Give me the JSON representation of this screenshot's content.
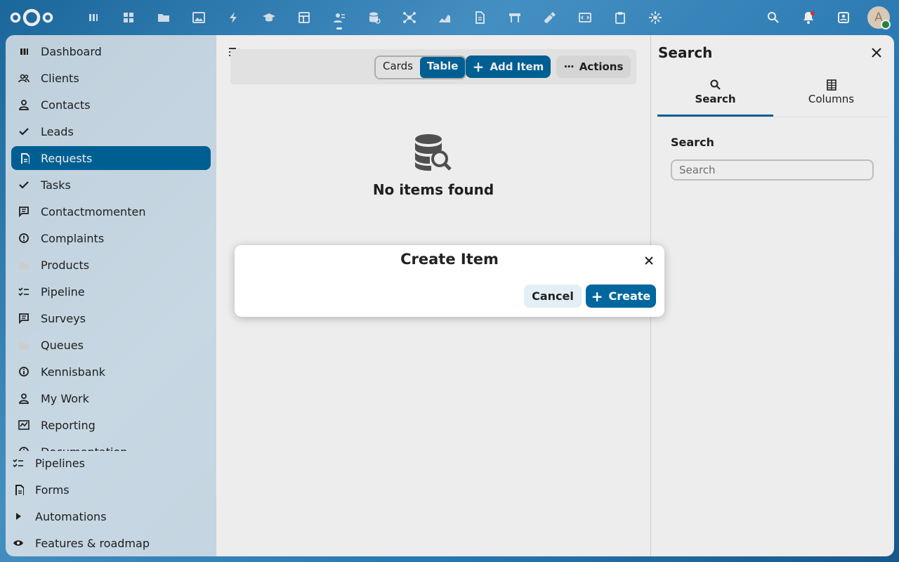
{
  "header": {
    "logo": "nextcloud-logo",
    "apps": [
      "app-dashboard-icon",
      "dashboard-grid-icon",
      "files-icon",
      "photos-icon",
      "activity-icon",
      "learning-icon",
      "tables-icon",
      "contacts-icon",
      "database-icon",
      "hub-icon",
      "analytics-icon",
      "document-icon",
      "board-icon",
      "tools-icon",
      "code-icon",
      "clipboard-icon",
      "settings-icon"
    ],
    "active_app_index": 7,
    "user_initial": "A"
  },
  "nav": {
    "items": [
      {
        "label": "Dashboard",
        "icon": "dashboard-icon"
      },
      {
        "label": "Clients",
        "icon": "clients-icon"
      },
      {
        "label": "Contacts",
        "icon": "contact-icon"
      },
      {
        "label": "Leads",
        "icon": "check-icon"
      },
      {
        "label": "Requests",
        "icon": "document-icon",
        "active": true
      },
      {
        "label": "Tasks",
        "icon": "check-icon"
      },
      {
        "label": "Contactmomenten",
        "icon": "message-icon"
      },
      {
        "label": "Complaints",
        "icon": "alert-icon"
      },
      {
        "label": "Products",
        "icon": "folder-icon"
      },
      {
        "label": "Pipeline",
        "icon": "checklist-icon"
      },
      {
        "label": "Surveys",
        "icon": "message-icon"
      },
      {
        "label": "Queues",
        "icon": "folder-icon"
      },
      {
        "label": "Kennisbank",
        "icon": "info-icon"
      },
      {
        "label": "My Work",
        "icon": "contact-icon"
      },
      {
        "label": "Reporting",
        "icon": "chart-icon"
      },
      {
        "label": "Documentation",
        "icon": "info-icon"
      }
    ],
    "footer": [
      {
        "label": "Pipelines",
        "icon": "checklist-icon"
      },
      {
        "label": "Forms",
        "icon": "document-icon"
      },
      {
        "label": "Automations",
        "icon": "play-icon"
      },
      {
        "label": "Features & roadmap",
        "icon": "eye-icon"
      }
    ]
  },
  "toolbar": {
    "view_cards": "Cards",
    "view_table": "Table",
    "add_item": "Add Item",
    "actions": "Actions"
  },
  "empty": {
    "title": "No items found"
  },
  "sidebar": {
    "title": "Search",
    "tab_search": "Search",
    "tab_columns": "Columns",
    "search_label": "Search",
    "search_placeholder": "Search"
  },
  "modal": {
    "title": "Create Item",
    "cancel": "Cancel",
    "create": "Create"
  },
  "colors": {
    "primary": "#00679e"
  }
}
